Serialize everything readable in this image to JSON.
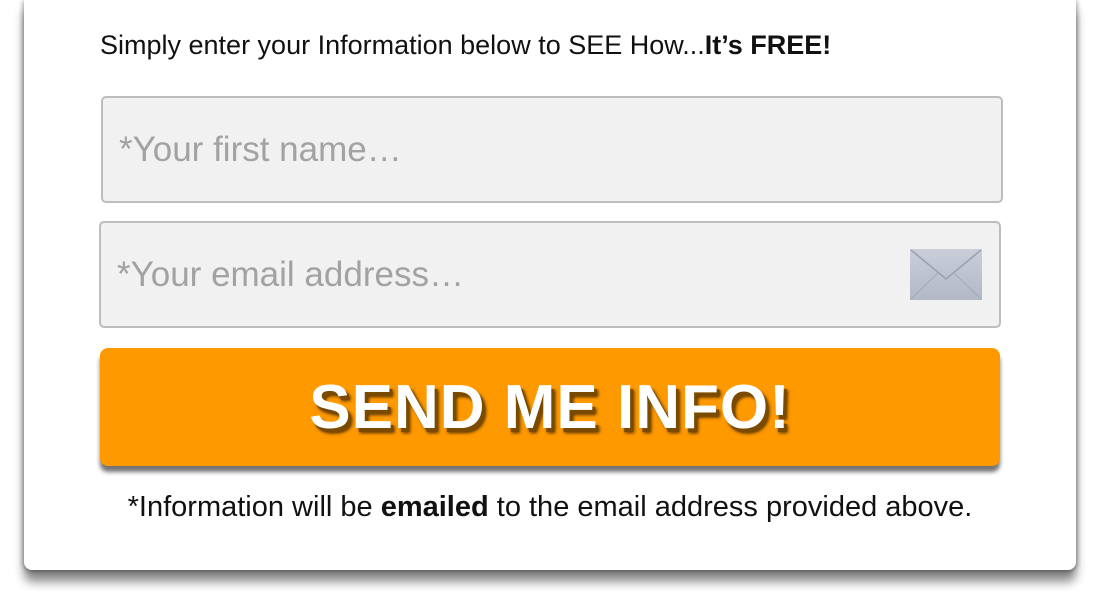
{
  "headline": {
    "text": "Simply enter your Information below to SEE How...",
    "emphasis": "It’s FREE!"
  },
  "form": {
    "first_name": {
      "placeholder": "*Your first name…",
      "value": ""
    },
    "email": {
      "placeholder": "*Your email address…",
      "value": "",
      "icon": "envelope-icon"
    },
    "submit_label": "SEND ME INFO!"
  },
  "footnote": {
    "before": "*Information will be ",
    "emphasis": "emailed",
    "after": " to the email address provided above."
  },
  "colors": {
    "button": "#ff9900",
    "field_bg": "#f1f1f1",
    "field_border": "#bdbdbd",
    "placeholder": "#a2a2a2"
  }
}
